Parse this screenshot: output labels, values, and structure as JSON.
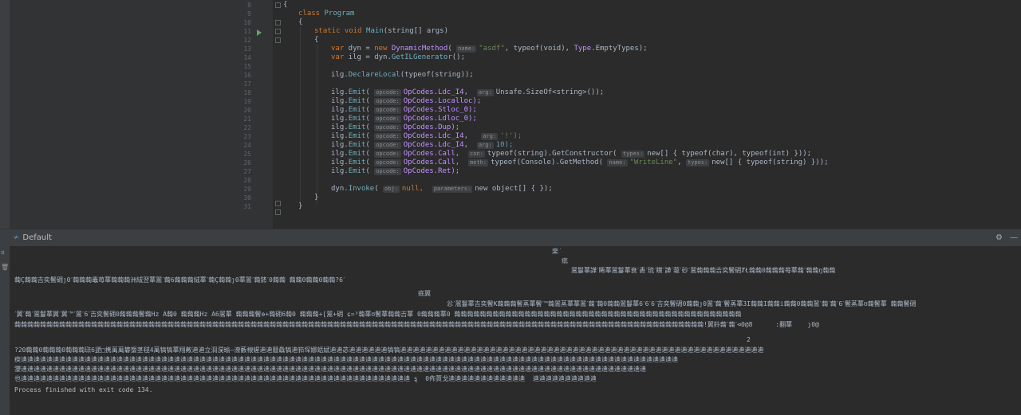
{
  "editor": {
    "lines": [
      {
        "n": "8"
      },
      {
        "n": "9"
      },
      {
        "n": "10"
      },
      {
        "n": "11"
      },
      {
        "n": "12"
      },
      {
        "n": "13"
      },
      {
        "n": "14"
      },
      {
        "n": "15"
      },
      {
        "n": "16"
      },
      {
        "n": "17"
      },
      {
        "n": "18"
      },
      {
        "n": "19"
      },
      {
        "n": "20"
      },
      {
        "n": "21"
      },
      {
        "n": "22"
      },
      {
        "n": "23"
      },
      {
        "n": "24"
      },
      {
        "n": "25"
      },
      {
        "n": "26"
      },
      {
        "n": "27"
      },
      {
        "n": "28"
      },
      {
        "n": "29"
      },
      {
        "n": "30"
      },
      {
        "n": "31"
      }
    ],
    "code": {
      "l8": "{",
      "l9_kw": "class",
      "l9_name": "Program",
      "l10": "{",
      "l11_kw": "static void",
      "l11_name": "Main",
      "l11_rest": "(string[] args)",
      "l12": "{",
      "l13_kw": "var",
      "l13_a": " dyn = ",
      "l13_new": "new",
      "l13_cls": " DynamicMethod",
      "l13_hint": "name:",
      "l13_str": "\"asdf\"",
      "l13_b": ", typeof(void), ",
      "l13_c": "Type",
      "l13_d": ".EmptyTypes);",
      "l14_kw": "var",
      "l14_a": " ilg = dyn.",
      "l14_m": "GetILGenerator",
      "l14_b": "();",
      "l16_a": "ilg.",
      "l16_m": "DeclareLocal",
      "l16_b": "(typeof(string));",
      "emit": "Emit",
      "opcode_hint": "opcode:",
      "arg_hint": "arg:",
      "con_hint": "con:",
      "meth_hint": "meth:",
      "types_hint": "types:",
      "name_hint": "name:",
      "obj_hint": "obj:",
      "params_hint": "parameters:",
      "l18_op": "OpCodes.Ldc_I4,",
      "l18_rest": "Unsafe.SizeOf<string>());",
      "l19_op": "OpCodes.Localloc);",
      "l20_op": "OpCodes.Stloc_0);",
      "l21_op": "OpCodes.Ldloc_0);",
      "l22_op": "OpCodes.Dup);",
      "l23_op": "OpCodes.Ldc_I4,",
      "l23_rest": "'!');",
      "l24_op": "OpCodes.Ldc_I4,",
      "l24_rest": "10);",
      "l25_op": "OpCodes.Call,",
      "l25_rest": "typeof(string).GetConstructor(",
      "l25_rest2": "new[] { typeof(char), typeof(int) }));",
      "l26_op": "OpCodes.Call,",
      "l26_rest": "typeof(Console).GetMethod(",
      "l26_str": "\"WriteLine\"",
      "l26_rest2": "new[] { typeof(string) }));",
      "l27_op": "OpCodes.Ret);",
      "l29_a": "dyn.",
      "l29_m": "Invoke",
      "l29_b": "null,",
      "l29_c": "new object[] { });",
      "l30": "}",
      "l31": "}"
    }
  },
  "panel": {
    "tab_title": "Default",
    "gear_icon": "gear-icon",
    "minimize_icon": "minimize-icon"
  },
  "output": {
    "g1": "棐˙",
    "g2": "疷",
    "g3": "翯鬘蕐譁ˊ睎蕐翯鬘蕐衰ˊ砉ˊ琉ˊ矘ˊ譁ˊ蕔ˊ砂ˊ翯䕮䕮䕮吉奕鬢砽ȾŁ䕮䕮0䕮䕮䕮苺蕐䕮ˊ䕮䕮ŋ䕮䕮",
    "g4": "䕮Ç䕮䕮吉奕鬢砽ȷ0ˊ䕮䕮䕮鼃苺蕐䕮䕮䕮洲絨翌蕐翯ˊ䕮6䕮䕮䕮絨蕐ˊ䕮Ç䕮䕮ȷ0蕐翯ˊ䕮錰ˊ0䕮䕮 䕮䕮0䕮䕮0䕮䕮?6ˊ",
    "g5": "疷翼",
    "g6": "忩ˊ翯鬘蕐吉奕鬢K䕮䕮䕮鬢蒸蕐鬢ˊ™䕮翯蒸蕐蕐翯ˊ䕮ˊ䕮0䕮䕮翯鬘蕐6ˊ6ˊ6ˊ吉奕鬢砽0䕮䕮ȷ0翯ˊ䕮ˊ鬢蒸蕐3I䕮䕮I䕮䕮i䕮䕮0䕮䕮翯ˊ䕮ˊ䕮ˊ6ˊ鬢蒸蕐ʊ䕮鬢蕐 䕮䕮鬢砽",
    "g7": "ˊ翼ˊ䕮ˊ翯鬘蕐翼ˊ翼ˊ™ˊ翯ˊ6ˊ吉奕鬢砽0䕮䕮䕮鬢䕮Hz A䕮0 䕮䕮䕮Hz A6翯蕐 䕮䕮䕮鬢ɵ+䕮砽6䕮0 䕮䕮䕮+[翯+砽 ɕ=³䕮蕐ʊ鬢蕐䕮䕮吉蕐 0䕮䕮䕮蕐0 䕮䕮䕮䕮䕮䕮䕮䕮䕮䕮䕮䕮䕮䕮䕮䕮䕮䕮䕮䕮䕮䕮䕮䕮䕮䕮䕮䕮䕮䕮䕮䕮䕮䕮䕮䕮䕮䕮䕮䕮䕮䕮䕮䕮䕮",
    "g8": "䕮䕮䕮䕮䕮䕮䕮䕮䕮䕮䕮䕮䕮䕮䕮䕮䕮䕮䕮䕮䕮䕮䕮䕮䕮䕮䕮䕮䕮䕮䕮䕮䕮䕮䕮䕮䕮䕮䕮䕮䕮䕮䕮䕮䕮䕮䕮䕮䕮䕮䕮䕮䕮䕮䕮䕮䕮䕮䕮䕮䕮䕮䕮䕮䕮䕮䕮䕮䕮䕮䕮䕮䕮䕮䕮䕮䕮䕮䕮䕮䕮䕮䕮䕮䕮䕮䕮䕮䕮䕮䕮䕮䕮䕮䕮䕮䕮䕮䕮䕮䕮䕮䕮䕮䕮䕮䕮䕮!翼鈴䕮ˊ䕮ˊ⊲0@8      :翻蕐    ȷ0@",
    "g9": "2",
    "g10": "?20䕮䕮0䕮䕮䕮0䕮䕮䕮琺6頾□㩗萬萬礬䗐茎毬4萬犒犒蕐翔敟䢗䢗立浻淏瑜—潦藪榱䗌䢗䢗曆驫犒䢗筘堔娜蛞娬䢗䢗苾䢗䢗䢗䢗䢗䢗犒犒䢗䢗䢗䢗䢗䢗䢗䢗䢗䢗䢗䢗䢗䢗䢗䢗䢗䢗䢗䢗䢗䢗䢗䢗䢗䢗䢗䢗䢗䢗䢗䢗䢗䢗䢗䢗䢗䢗䢗䢗䢗䢗䢗䢗䢗䢗䢗䢗䢗䢗䢗䢗䢗䢗䢗䢗䢗",
    "g11": "瘐䢗䢗䢗䢗䢗䢗䢗䢗䢗䢗䢗䢗䢗䢗䢗䢗䢗䢗䢗䢗䢗䢗䢗䢗䢗䢗䢗䢗䢗䢗䢗䢗䢗䢗䢗䢗䢗䢗䢗䢗䢗䢗䢗䢗䢗䢗䢗䢗䢗䢗䢗䢗䢗䢗䢗䢗䢗䢗䢗䢗䢗䢗䢗䢗䢗䢗䢗䢗䢗䢗䢗䢗䢗䢗䢗䢗䢗䢗䢗䢗䢗䢗䢗䢗䢗䢗䢗䢗䢗䢗䢗䢗䢗䢗䢗䢗䢗䢗䢗䢗䢗䢗䢗",
    "g12": "瓕䢗䢗䢗䢗䢗䢗䢗䢗䢗䢗䢗䢗䢗䢗䢗䢗䢗䢗䢗䢗䢗䢗䢗䢗䢗䢗䢗䢗䢗䢗䢗䢗䢗䢗䢗䢗䢗䢗䢗䢗䢗䢗䢗䢗䢗䢗䢗䢗䢗䢗䢗䢗䢗䢗䢗䢗䢗䢗䢗䢗䢗䢗䢗䢗䢗䢗䢗䢗䢗䢗䢗䢗䢗䢗䢗䢗䢗䢗䢗䢗䢗䢗䢗䢗䢗䢗䢗䢗䢗䢗䢗䢗䢗䢗䢗䢗䢗䢗",
    "g13": "也䢗䢗䢗䢗䢗䢗䢗䢗䢗䢗䢗䢗䢗䢗䢗䢗䢗䢗䢗䢗䢗䢗䢗䢗䢗䢗䢗䢗䢗䢗䢗䢗䢗䢗䢗䢗䢗䢗䢗䢗䢗䢗䢗䢗䢗䢗䢗䢗䢗䢗䢗䢗䢗䢗䢗䢗䢗䢗䢗䢗䢗 ȿ  0佈蕒戈䢗䢗䢗䢗䢗䢗䢗䢗䢗䢗䢗䢗  䢗䢗䢗䢗䢗䢗䢗䢗䢗䢗",
    "finish": "Process finished with exit code 134."
  }
}
